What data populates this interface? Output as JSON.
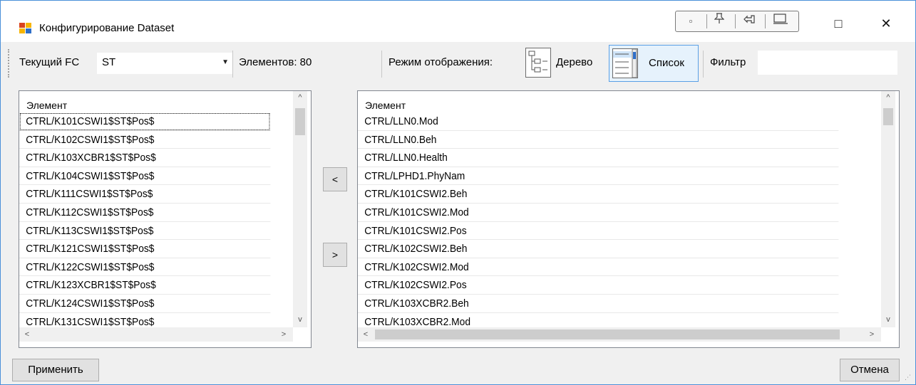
{
  "window": {
    "title": "Конфигурирование Dataset",
    "minimize_glyph": "□",
    "close_glyph": "✕"
  },
  "mini_toolbar": {
    "icons": [
      "small-square-icon",
      "pin-icon",
      "dock-icon",
      "float-window-icon"
    ]
  },
  "toolbar": {
    "current_fc_label": "Текущий FC",
    "current_fc_value": "ST",
    "elements_label": "Элементов: 80",
    "display_mode_label": "Режим отображения:",
    "tree_label": "Дерево",
    "list_label": "Список",
    "filter_label": "Фильтр",
    "filter_value": ""
  },
  "left_list": {
    "header": "Элемент",
    "items": [
      "CTRL/K101CSWI1$ST$Pos$",
      "CTRL/K102CSWI1$ST$Pos$",
      "CTRL/K103XCBR1$ST$Pos$",
      "CTRL/K104CSWI1$ST$Pos$",
      "CTRL/K111CSWI1$ST$Pos$",
      "CTRL/K112CSWI1$ST$Pos$",
      "CTRL/K113CSWI1$ST$Pos$",
      "CTRL/K121CSWI1$ST$Pos$",
      "CTRL/K122CSWI1$ST$Pos$",
      "CTRL/K123XCBR1$ST$Pos$",
      "CTRL/K124CSWI1$ST$Pos$",
      "CTRL/K131CSWI1$ST$Pos$"
    ]
  },
  "right_list": {
    "header": "Элемент",
    "items": [
      "CTRL/LLN0.Mod",
      "CTRL/LLN0.Beh",
      "CTRL/LLN0.Health",
      "CTRL/LPHD1.PhyNam",
      "CTRL/K101CSWI2.Beh",
      "CTRL/K101CSWI2.Mod",
      "CTRL/K101CSWI2.Pos",
      "CTRL/K102CSWI2.Beh",
      "CTRL/K102CSWI2.Mod",
      "CTRL/K102CSWI2.Pos",
      "CTRL/K103XCBR2.Beh",
      "CTRL/K103XCBR2.Mod"
    ]
  },
  "move": {
    "left_label": "<",
    "right_label": ">"
  },
  "footer": {
    "apply_label": "Применить",
    "cancel_label": "Отмена"
  },
  "colors": {
    "accent": "#5aa0e6",
    "window_bg": "#f0f0f0"
  }
}
